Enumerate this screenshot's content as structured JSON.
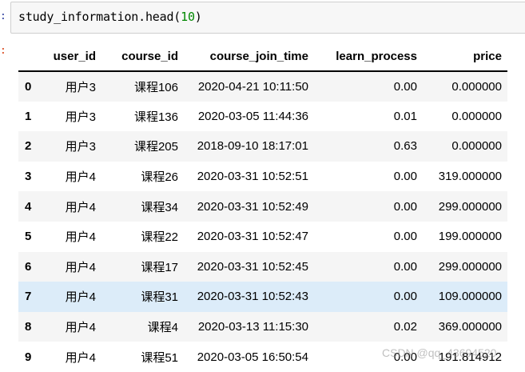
{
  "prompts": {
    "in": ":",
    "out": ":"
  },
  "code": {
    "fn": "study_information.head(",
    "arg": "10",
    "close": ")"
  },
  "table": {
    "columns": [
      "",
      "user_id",
      "course_id",
      "course_join_time",
      "learn_process",
      "price"
    ],
    "rows": [
      {
        "index": "0",
        "user_id": "用户3",
        "course_id": "课程106",
        "course_join_time": "2020-04-21 10:11:50",
        "learn_process": "0.00",
        "price": "0.000000"
      },
      {
        "index": "1",
        "user_id": "用户3",
        "course_id": "课程136",
        "course_join_time": "2020-03-05 11:44:36",
        "learn_process": "0.01",
        "price": "0.000000"
      },
      {
        "index": "2",
        "user_id": "用户3",
        "course_id": "课程205",
        "course_join_time": "2018-09-10 18:17:01",
        "learn_process": "0.63",
        "price": "0.000000"
      },
      {
        "index": "3",
        "user_id": "用户4",
        "course_id": "课程26",
        "course_join_time": "2020-03-31 10:52:51",
        "learn_process": "0.00",
        "price": "319.000000"
      },
      {
        "index": "4",
        "user_id": "用户4",
        "course_id": "课程34",
        "course_join_time": "2020-03-31 10:52:49",
        "learn_process": "0.00",
        "price": "299.000000"
      },
      {
        "index": "5",
        "user_id": "用户4",
        "course_id": "课程22",
        "course_join_time": "2020-03-31 10:52:47",
        "learn_process": "0.00",
        "price": "199.000000"
      },
      {
        "index": "6",
        "user_id": "用户4",
        "course_id": "课程17",
        "course_join_time": "2020-03-31 10:52:45",
        "learn_process": "0.00",
        "price": "299.000000"
      },
      {
        "index": "7",
        "user_id": "用户4",
        "course_id": "课程31",
        "course_join_time": "2020-03-31 10:52:43",
        "learn_process": "0.00",
        "price": "109.000000"
      },
      {
        "index": "8",
        "user_id": "用户4",
        "course_id": "课程4",
        "course_join_time": "2020-03-13 11:15:30",
        "learn_process": "0.02",
        "price": "369.000000"
      },
      {
        "index": "9",
        "user_id": "用户4",
        "course_id": "课程51",
        "course_join_time": "2020-03-05 16:50:54",
        "learn_process": "0.00",
        "price": "191.814912"
      }
    ],
    "highlighted_row": "7"
  },
  "watermark": "CSDN @qq_43694520",
  "colors": {
    "in_prompt": "#303f9f",
    "out_prompt": "#d84315",
    "highlight": "#dcecf9",
    "stripe": "#f5f5f5"
  }
}
